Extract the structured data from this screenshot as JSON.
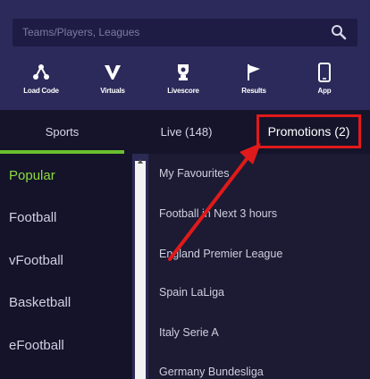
{
  "search": {
    "placeholder": "Teams/Players, Leagues"
  },
  "quick_actions": [
    {
      "label": "Load Code",
      "icon": "load-code-icon"
    },
    {
      "label": "Virtuals",
      "icon": "virtuals-icon"
    },
    {
      "label": "Livescore",
      "icon": "livescore-icon"
    },
    {
      "label": "Results",
      "icon": "results-flag-icon"
    },
    {
      "label": "App",
      "icon": "phone-app-icon"
    }
  ],
  "tabs": {
    "sports": "Sports",
    "live": "Live (148)",
    "promotions": "Promotions (2)"
  },
  "left_menu": [
    "Popular",
    "Football",
    "vFootball",
    "Basketball",
    "eFootball"
  ],
  "right_menu": [
    "My Favourites",
    "Football in Next 3 hours",
    "England Premier League",
    "Spain LaLiga",
    "Italy Serie A",
    "Germany Bundesliga"
  ],
  "colors": {
    "header_bg": "#2b2a5a",
    "active_green": "#8ddc3c",
    "highlight_red": "#e01a1a"
  }
}
